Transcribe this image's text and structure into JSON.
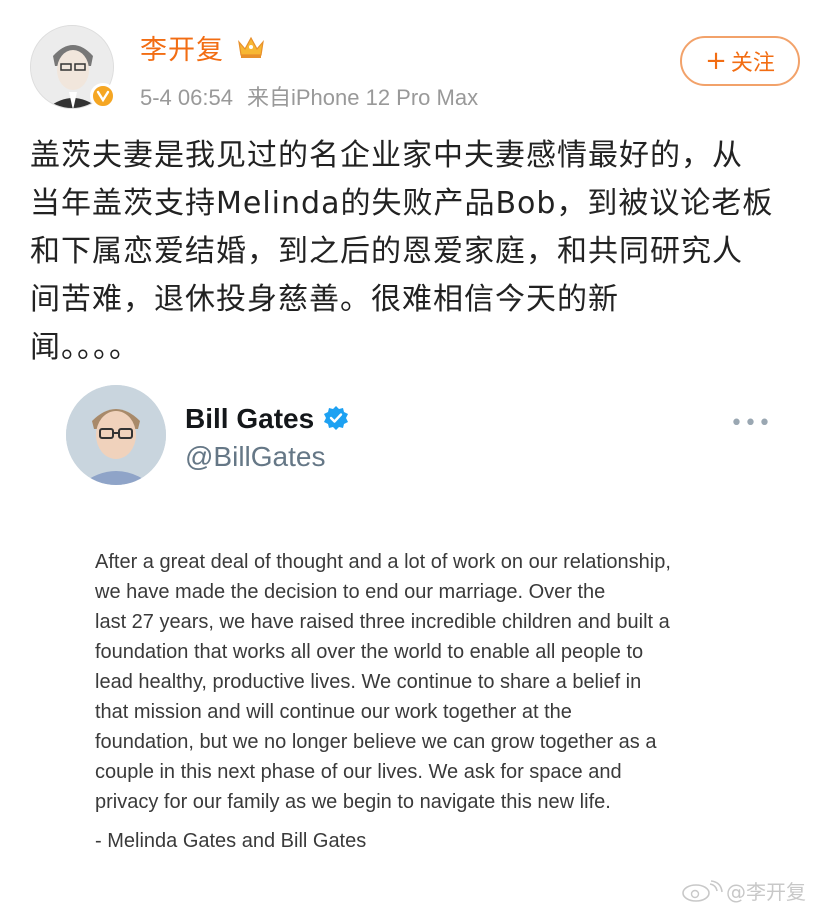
{
  "post": {
    "author_name": "李开复",
    "timestamp": "5-4 06:54",
    "source": "来自iPhone 12 Pro Max",
    "follow_label": "关注",
    "body_lines": [
      "盖茨夫妻是我见过的名企业家中夫妻感情最好的，从",
      "当年盖茨支持Melinda的失败产品Bob，到被议论老板",
      "和下属恋爱结婚，到之后的恩爱家庭，和共同研究人",
      "间苦难，退休投身慈善。很难相信今天的新",
      "闻。。。。"
    ]
  },
  "embedded_tweet": {
    "display_name": "Bill Gates",
    "handle": "@BillGates",
    "more_label": "•••",
    "letter_lines": [
      "After a great deal of thought and a lot of work on our relationship,",
      "we have made the decision to end our marriage. Over the",
      "last 27 years, we have raised three incredible children and built a",
      "foundation that works all over the world to enable all people to",
      "lead healthy, productive lives. We continue to share a belief in",
      "that mission and will continue our work together at the",
      "foundation, but we no longer believe we can grow together as a",
      "couple in this next phase of our lives. We ask for space and",
      "privacy for our family as we begin to navigate this new life."
    ],
    "signature": "- Melinda Gates and Bill Gates"
  },
  "watermark": "@李开复",
  "icons": {
    "author_avatar": "portrait-avatar",
    "vip_badge": "verified-v-icon",
    "crown": "crown-icon",
    "tw_verified": "blue-check-icon",
    "weibo_logo": "weibo-eye-icon"
  },
  "colors": {
    "accent_orange": "#f26d13",
    "follow_border": "#f2a26a",
    "twitter_blue": "#1da1f2",
    "muted_text": "#999999"
  }
}
